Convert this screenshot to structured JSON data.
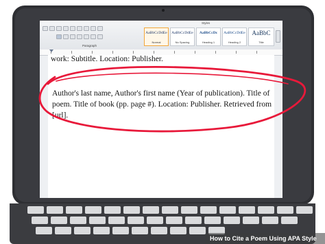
{
  "ribbon": {
    "paragraph_label": "Paragraph",
    "styles_label": "Styles",
    "styles": [
      {
        "sample": "AaBbCcDdEe",
        "label": "Normal",
        "selected": true
      },
      {
        "sample": "AaBbCcDdEe",
        "label": "No Spacing",
        "selected": false
      },
      {
        "sample": "AaBbCcDc",
        "label": "Heading 1",
        "selected": false
      },
      {
        "sample": "AaBbCcDdEe",
        "label": "Heading 2",
        "selected": false
      },
      {
        "sample": "AaBbC",
        "label": "Title",
        "selected": false
      }
    ]
  },
  "document": {
    "line_top": "work: Subtitle. Location: Publisher.",
    "citation_lines": [
      "Author's last name, Author's first name (Year of publication). Title of",
      "poem. Title of book (pp. page #). Location: Publisher. Retrieved from",
      "[url]."
    ],
    "highlight_color": "#e8193a"
  },
  "caption": {
    "text": "How to Cite a Poem Using APA Style"
  }
}
